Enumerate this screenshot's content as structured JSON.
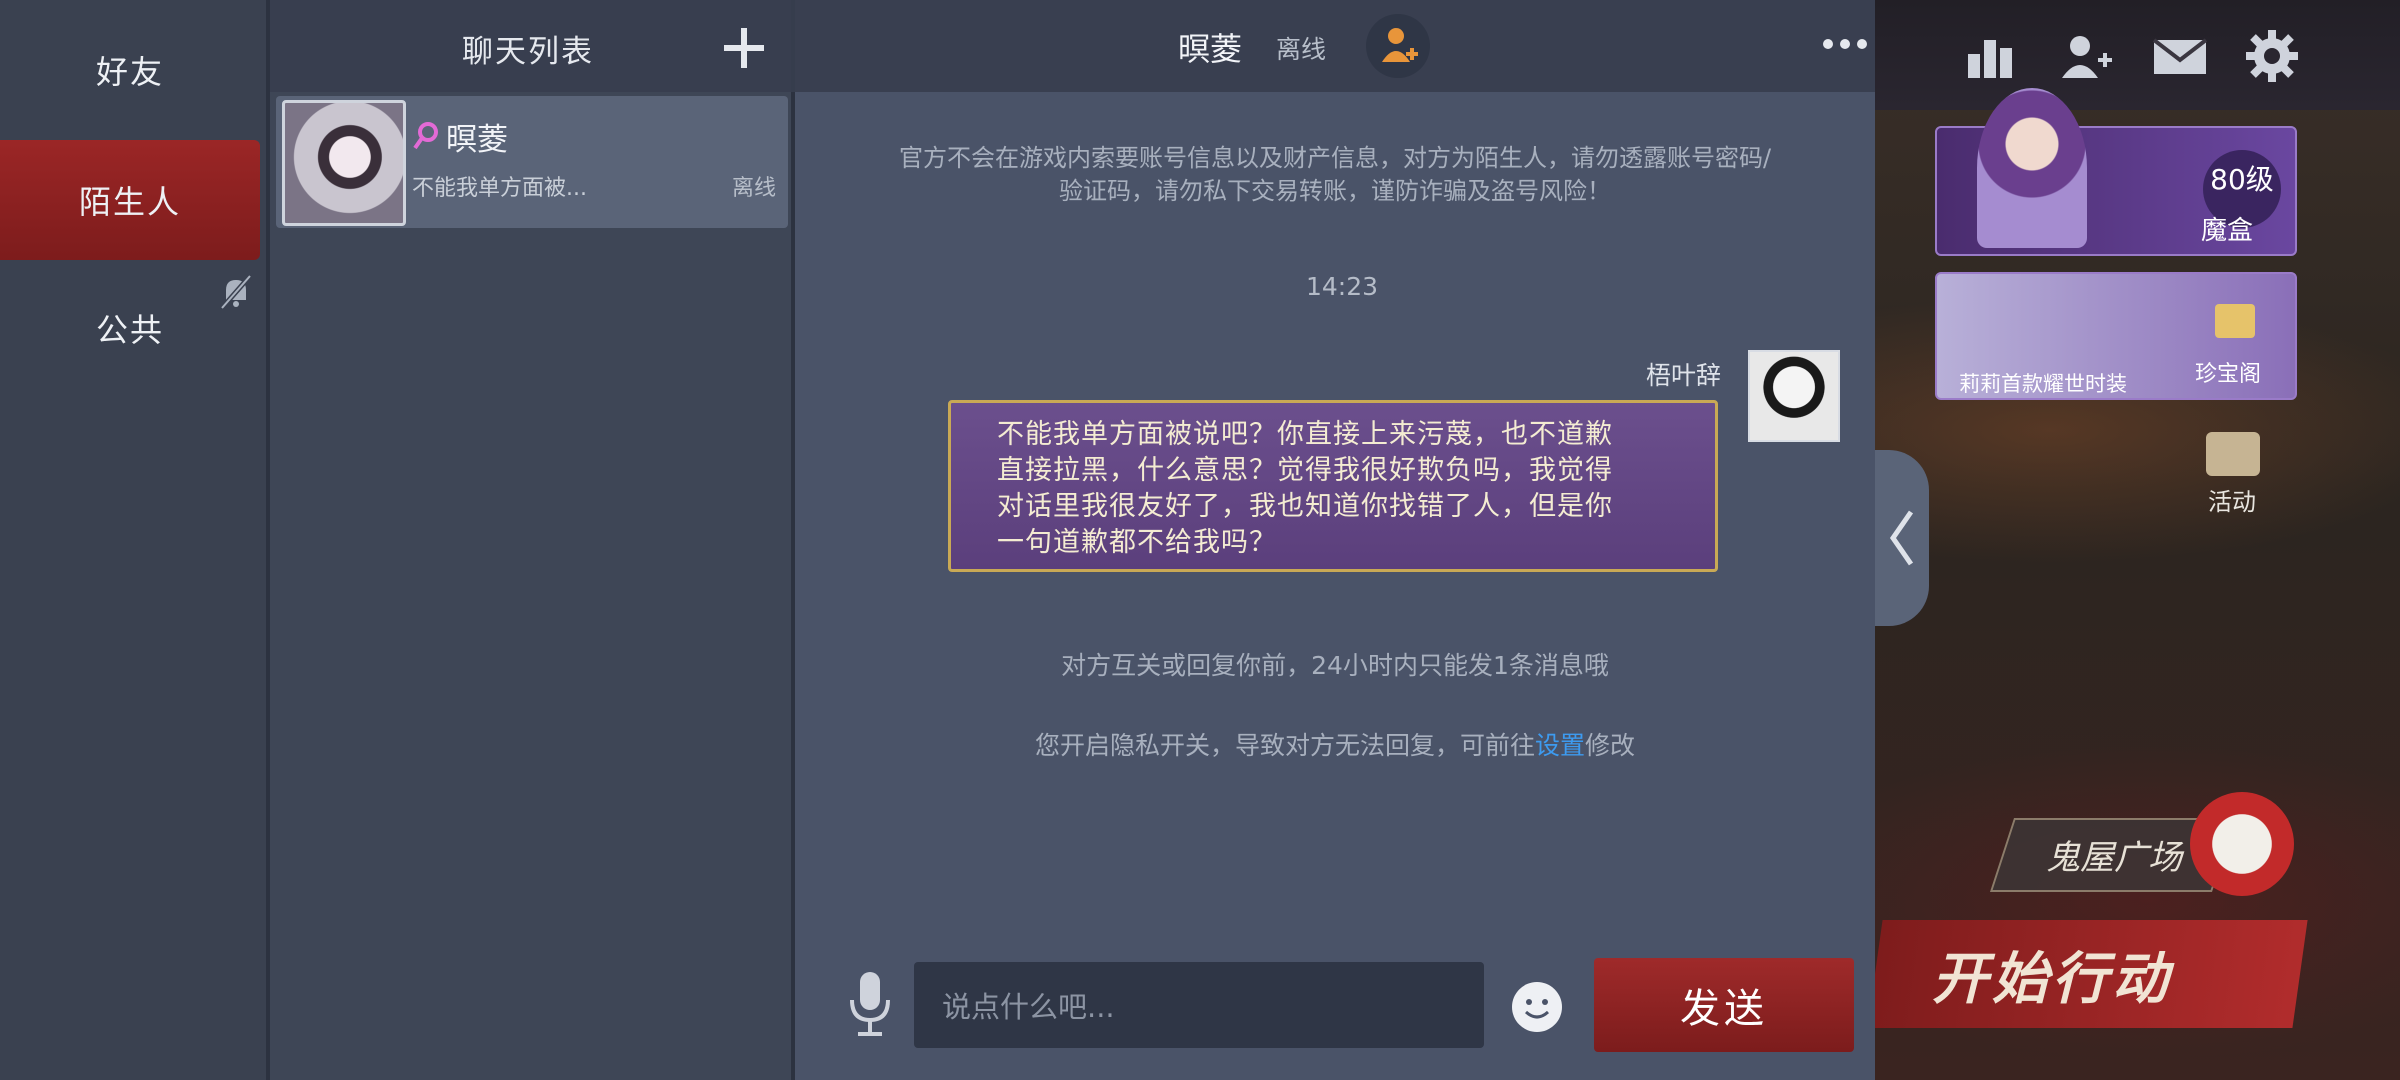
{
  "sidebar": {
    "tabs": [
      {
        "label": "好友",
        "selected": false
      },
      {
        "label": "陌生人",
        "selected": true
      },
      {
        "label": "公共",
        "selected": false
      }
    ],
    "muted_icon": "bell-off-icon"
  },
  "chat_list": {
    "title": "聊天列表",
    "add_icon": "plus-icon",
    "items": [
      {
        "name": "暝菱",
        "preview": "不能我单方面被...",
        "status": "离线",
        "badge_icon": "magnifier-search-icon"
      }
    ]
  },
  "chat_header": {
    "contact_name": "暝菱",
    "status": "离线",
    "add_friend_icon": "add-friend-icon",
    "more_icon": "more-dots-icon"
  },
  "chat": {
    "warning": "官方不会在游戏内索要账号信息以及财产信息，对方为陌生人，请勿透露账号密码/验证码，请勿私下交易转账，谨防诈骗及盗号风险！",
    "timestamp": "14:23",
    "sender_name": "梧叶辞",
    "message_lines": [
      "不能我单方面被说吧？你直接上来污蔑，也不道歉",
      "直接拉黑，什么意思？觉得我很好欺负吗，我觉得",
      "对话里我很友好了，我也知道你找错了人，但是你",
      "一句道歉都不给我吗？"
    ],
    "notice_limit": "对方互关或回复你前，24小时内只能发1条消息哦",
    "notice_privacy_prefix": "您开启隐私开关，导致对方无法回复，可前往",
    "notice_privacy_link": "设置",
    "notice_privacy_suffix": "修改"
  },
  "composer": {
    "placeholder": "说点什么吧...",
    "voice_icon": "microphone-icon",
    "emoji_icon": "emoji-smile-icon",
    "send_label": "发送"
  },
  "game": {
    "level_label": "80级",
    "mystery_box_label": "魔盒",
    "treasure_label": "珍宝阁",
    "promo_text": "莉莉首款耀世时装",
    "activity_label": "活动",
    "plaza_label": "鬼屋广场",
    "start_label": "开始行动",
    "top_icons": [
      "leaderboard-icon",
      "add-user-icon",
      "mail-icon",
      "gear-icon"
    ]
  },
  "colors": {
    "accent_red": "#8f2424",
    "bubble_purple": "#6b4f8d",
    "bubble_border": "#c9a955",
    "link_blue": "#3d9bf0"
  }
}
